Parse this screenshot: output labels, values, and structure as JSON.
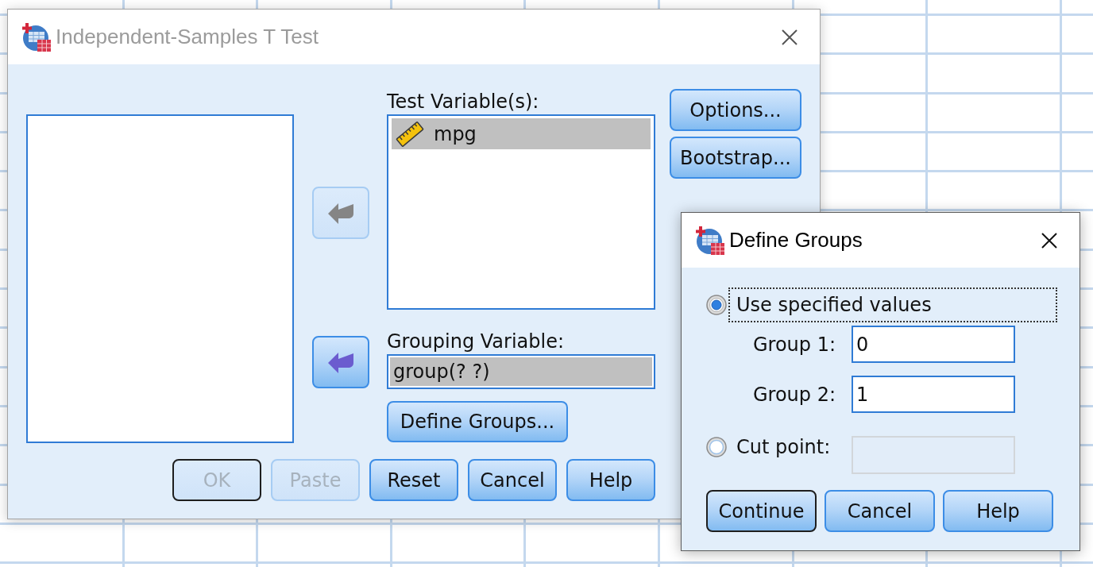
{
  "main_dialog": {
    "title": "Independent-Samples T Test",
    "active": false,
    "test_variables": {
      "label": "Test Variable(s):",
      "move_button": {
        "disabled": true
      },
      "items": [
        {
          "name": "mpg",
          "selected": true
        }
      ]
    },
    "side_buttons": [
      {
        "label": "Options..."
      },
      {
        "label": "Bootstrap..."
      }
    ],
    "grouping_variable": {
      "label": "Grouping Variable:",
      "move_button": {
        "disabled": false
      },
      "value": "group(? ?)",
      "selected": true,
      "define_button": {
        "label": "Define Groups..."
      }
    },
    "buttons": [
      {
        "label": "OK",
        "disabled": true,
        "default": true
      },
      {
        "label": "Paste",
        "disabled": true,
        "default": false
      },
      {
        "label": "Reset",
        "disabled": false,
        "default": false
      },
      {
        "label": "Cancel",
        "disabled": false,
        "default": false
      },
      {
        "label": "Help",
        "disabled": false,
        "default": false
      }
    ]
  },
  "define_groups_dialog": {
    "title": "Define Groups",
    "active": true,
    "options": [
      {
        "kind": "values",
        "label": "Use specified values",
        "selected": true,
        "focused": true,
        "fields": [
          {
            "label": "Group 1:",
            "value": "0",
            "disabled": false
          },
          {
            "label": "Group 2:",
            "value": "1",
            "disabled": false
          }
        ]
      },
      {
        "kind": "cut",
        "label": "Cut point:",
        "selected": false,
        "focused": false,
        "field": {
          "disabled": true
        }
      }
    ],
    "buttons": [
      {
        "label": "Continue",
        "disabled": false,
        "default": true
      },
      {
        "label": "Cancel",
        "disabled": false,
        "default": false
      },
      {
        "label": "Help",
        "disabled": false,
        "default": false
      }
    ]
  }
}
